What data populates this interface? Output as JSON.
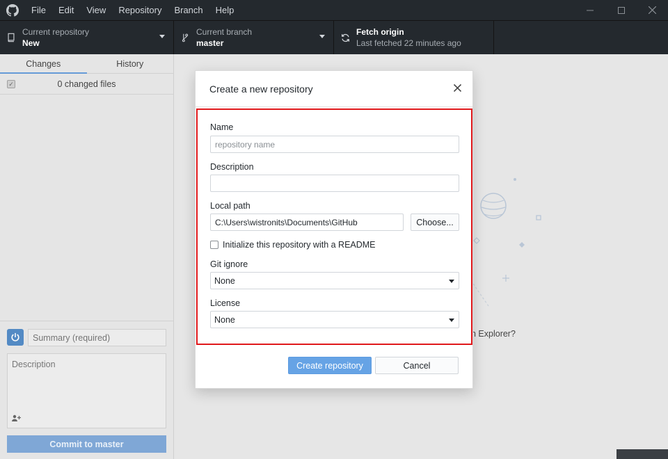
{
  "menu": {
    "items": [
      "File",
      "Edit",
      "View",
      "Repository",
      "Branch",
      "Help"
    ]
  },
  "toolbar": {
    "repo_label": "Current repository",
    "repo_value": "New",
    "branch_label": "Current branch",
    "branch_value": "master",
    "fetch_label": "Fetch origin",
    "fetch_sub": "Last fetched 22 minutes ago"
  },
  "sidebar": {
    "tabs": [
      "Changes",
      "History"
    ],
    "changed_files": "0 changed files",
    "summary_placeholder": "Summary (required)",
    "description_placeholder": "Description",
    "commit_button": "Commit to master"
  },
  "main": {
    "explorer_text": "n Explorer?"
  },
  "modal": {
    "title": "Create a new repository",
    "name_label": "Name",
    "name_placeholder": "repository name",
    "description_label": "Description",
    "description_value": "",
    "path_label": "Local path",
    "path_value": "C:\\Users\\wistronits\\Documents\\GitHub",
    "choose_button": "Choose...",
    "readme_label": "Initialize this repository with a README",
    "gitignore_label": "Git ignore",
    "gitignore_value": "None",
    "license_label": "License",
    "license_value": "None",
    "create_button": "Create repository",
    "cancel_button": "Cancel"
  },
  "colors": {
    "titlebar_bg": "#24292e",
    "highlight_border": "#e0181b",
    "primary_button": "#66a3e5"
  }
}
